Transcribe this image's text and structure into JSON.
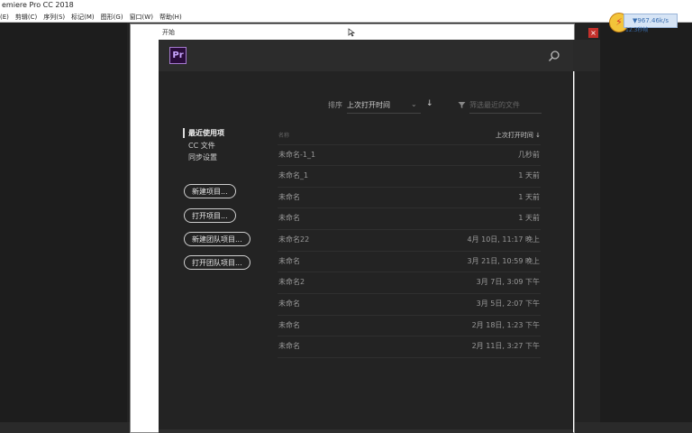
{
  "app": {
    "title": "emiere Pro CC 2018"
  },
  "menu": [
    "(E)",
    "剪辑(C)",
    "序列(S)",
    "标记(M)",
    "图形(G)",
    "窗口(W)",
    "帮助(H)"
  ],
  "badge": {
    "box_text": "▼967.46k/s",
    "sub_text": "12.3秒帧"
  },
  "dialog": {
    "title": "开始",
    "close_symbol": "×",
    "logo": "Pr",
    "sort": {
      "label": "排序",
      "value": "上次打开时间",
      "direction_symbol": "↓"
    },
    "filter_placeholder": "筛选最近的文件",
    "nav": {
      "recent": "最近使用项",
      "cc_files": "CC 文件",
      "sync_settings": "同步设置"
    },
    "buttons": [
      "新建项目...",
      "打开项目...",
      "新建团队项目...",
      "打开团队项目..."
    ],
    "table": {
      "col_name": "名称",
      "col_time": "上次打开时间 ↓",
      "rows": [
        {
          "name": "未命名-1_1",
          "time": "几秒前"
        },
        {
          "name": "未命名_1",
          "time": "1 天前"
        },
        {
          "name": "未命名",
          "time": "1 天前"
        },
        {
          "name": "未命名",
          "time": "1 天前"
        },
        {
          "name": "未命名22",
          "time": "4月 10日, 11:17 晚上"
        },
        {
          "name": "未命名",
          "time": "3月 21日, 10:59 晚上"
        },
        {
          "name": "未命名2",
          "time": "3月 7日, 3:09 下午"
        },
        {
          "name": "未命名",
          "time": "3月 5日, 2:07 下午"
        },
        {
          "name": "未命名",
          "time": "2月 18日, 1:23 下午"
        },
        {
          "name": "未命名",
          "time": "2月 11日, 3:27 下午"
        }
      ]
    }
  }
}
